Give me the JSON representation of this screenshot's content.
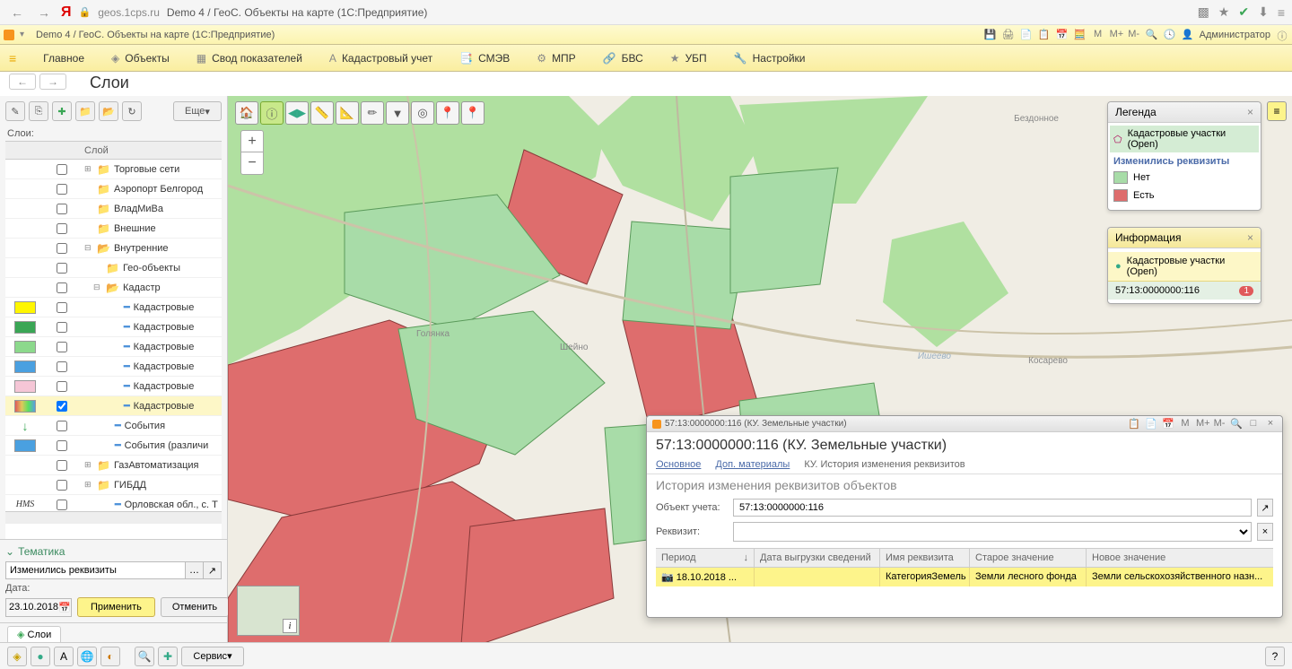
{
  "browser": {
    "url_host": "geos.1cps.ru",
    "url_title": "Demo 4 / ГеоС. Объекты на карте (1С:Предприятие)"
  },
  "app_tab": {
    "title": "Demo 4 / ГеоС. Объекты на карте  (1С:Предприятие)",
    "user": "Администратор"
  },
  "zoom_labels": {
    "m": "M",
    "mp": "M+",
    "mm": "M-"
  },
  "menu": {
    "main": "Главное",
    "objects": "Объекты",
    "svod": "Свод показателей",
    "kadastr": "Кадастровый учет",
    "smev": "СМЭВ",
    "mpr": "МПР",
    "bvs": "БВС",
    "ubp": "УБП",
    "settings": "Настройки"
  },
  "page": {
    "title": "Слои"
  },
  "lp": {
    "more": "Еще",
    "label_layers": "Слои:",
    "header_layer": "Слой"
  },
  "tree": {
    "torg": "Торговые сети",
    "aero": "Аэропорт Белгород",
    "vlad": "ВладМиВа",
    "ext": "Внешние",
    "int": "Внутренние",
    "geoobj": "Гео-объекты",
    "kad": "Кадастр",
    "k1": "Кадастровые",
    "k2": "Кадастровые",
    "k3": "Кадастровые",
    "k4": "Кадастровые",
    "k5": "Кадастровые",
    "k6": "Кадастровые",
    "sob": "События",
    "sobr": "События (различи",
    "gas": "ГазАвтоматизация",
    "gibdd": "ГИБДД",
    "orl": "Орловская обл., с. Т"
  },
  "tema": {
    "title": "Тематика",
    "val": "Изменились реквизиты",
    "date_label": "Дата:",
    "date": "23.10.2018",
    "apply": "Применить",
    "cancel": "Отменить"
  },
  "tab_sloi": "Слои",
  "legend": {
    "title": "Легенда",
    "layer": "Кадастровые участки (Open)",
    "sub": "Изменились реквизиты",
    "no": "Нет",
    "yes": "Есть"
  },
  "info": {
    "title": "Информация",
    "layer": "Кадастровые участки (Open)",
    "obj": "57:13:0000000:116",
    "count": "1"
  },
  "detail": {
    "wt": "57:13:0000000:116 (КУ. Земельные участки)",
    "title": "57:13:0000000:116 (КУ. Земельные участки)",
    "tab_main": "Основное",
    "tab_dop": "Доп. материалы",
    "tab_hist": "КУ. История изменения реквизитов",
    "subtitle": "История изменения реквизитов объектов",
    "f_obj_label": "Объект учета:",
    "f_obj_val": "57:13:0000000:116",
    "f_rek_label": "Реквизит:",
    "th_period": "Период",
    "th_date": "Дата выгрузки сведений",
    "th_name": "Имя реквизита",
    "th_old": "Старое значение",
    "th_new": "Новое значение",
    "row": {
      "period": "18.10.2018 ...",
      "date": "",
      "name": "КатегорияЗемель",
      "old": "Земли лесного фонда",
      "new": "Земли сельскохозяйственного назн..."
    }
  },
  "map_labels": {
    "bez": "Бездонное",
    "sheino": "Шейно",
    "kosarevo": "Косарево",
    "golyanka": "Голянка",
    "isheevo": "Ишеево"
  },
  "bottom": {
    "service": "Сервис"
  }
}
